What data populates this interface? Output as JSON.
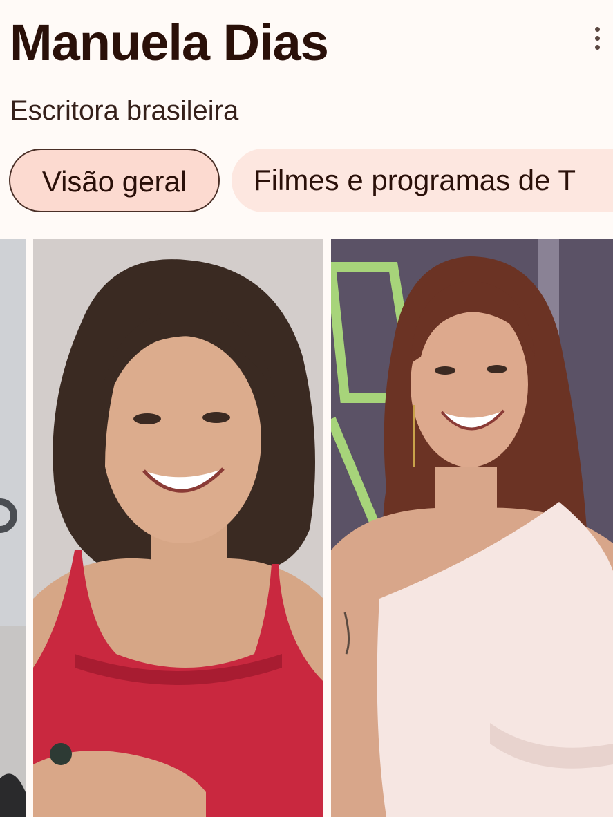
{
  "header": {
    "title": "Manuela Dias",
    "subtitle": "Escritora brasileira",
    "menu_icon": "more-vert-icon"
  },
  "tabs": [
    {
      "label": "Visão geral",
      "selected": true
    },
    {
      "label": "Filmes e programas de T",
      "selected": false
    }
  ],
  "gallery": {
    "images": [
      {
        "name": "partial-portrait-left"
      },
      {
        "name": "portrait-red-top"
      },
      {
        "name": "portrait-white-dress"
      }
    ]
  },
  "colors": {
    "background": "#fffaf7",
    "title": "#2a1009",
    "active_tab_bg": "#fcdad0",
    "active_tab_border": "#4a2f27",
    "inactive_tab_bg": "#fde7e0"
  }
}
